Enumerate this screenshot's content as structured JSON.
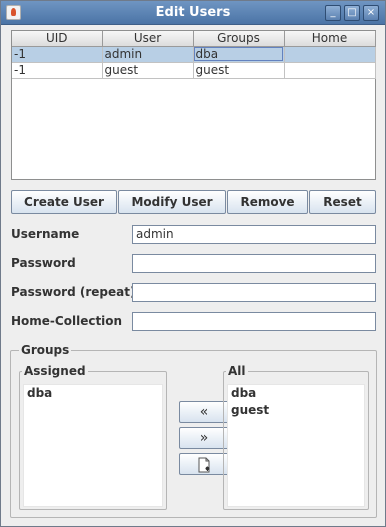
{
  "window": {
    "title": "Edit Users",
    "controls": {
      "minimize": "_",
      "maximize": "□",
      "close": "×"
    }
  },
  "table": {
    "headers": [
      "UID",
      "User",
      "Groups",
      "Home"
    ],
    "rows": [
      [
        "-1",
        "admin",
        "dba",
        ""
      ],
      [
        "-1",
        "guest",
        "guest",
        ""
      ]
    ],
    "selected_row": 0
  },
  "actions": {
    "create": "Create User",
    "modify": "Modify User",
    "remove": "Remove",
    "reset": "Reset"
  },
  "form": {
    "username_label": "Username",
    "username_value": "admin",
    "password_label": "Password",
    "password_value": "",
    "password_repeat_label": "Password (repeat)",
    "password_repeat_value": "",
    "home_label": "Home-Collection",
    "home_value": ""
  },
  "groups": {
    "title": "Groups",
    "assigned_title": "Assigned",
    "assigned": [
      "dba"
    ],
    "all_title": "All",
    "all": [
      "dba",
      "guest"
    ],
    "buttons": {
      "add": "«",
      "remove": "»",
      "new_icon": "new-group-icon"
    }
  }
}
